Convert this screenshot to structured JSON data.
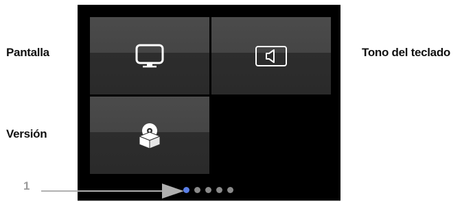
{
  "labels": {
    "pantalla": "Pantalla",
    "tono": "Tono del teclado",
    "version": "Versión"
  },
  "callout_number": "1",
  "tiles": [
    {
      "id": "pantalla",
      "icon": "monitor-icon"
    },
    {
      "id": "tono",
      "icon": "speaker-icon"
    },
    {
      "id": "version",
      "icon": "disc-box-icon"
    }
  ],
  "pagination": {
    "total": 5,
    "active_index": 0
  },
  "colors": {
    "screen_bg": "#000000",
    "tile_top": "#4b4b4b",
    "tile_bottom": "#2d2d2d",
    "dot_active": "#5a7fe8",
    "dot_inactive": "#8a8a8a",
    "callout_gray": "#9a9a9a"
  }
}
